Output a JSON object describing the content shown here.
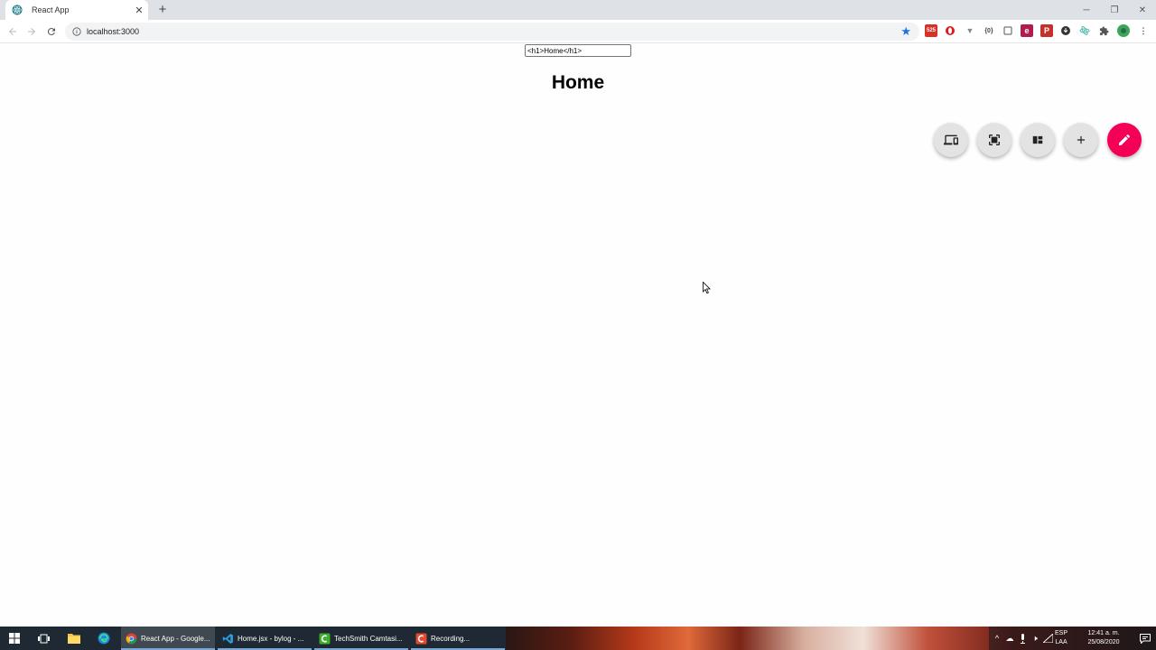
{
  "browser": {
    "tab": {
      "title": "React App",
      "favicon": "react-logo-icon"
    },
    "address": {
      "url": "localhost:3000",
      "info_icon": "info-icon"
    },
    "bookmark_icon": "star-icon",
    "extensions": [
      "gmail-extension-icon",
      "opera-extension-icon",
      "vue-devtools-icon",
      "json-extension-icon",
      "square-extension-icon",
      "extension-icon",
      "pdf-extension-icon",
      "download-extension-icon",
      "react-devtools-icon",
      "puzzle-extensions-icon",
      "profile-avatar"
    ],
    "gmail_badge": "525",
    "window_controls": {
      "minimize": "─",
      "restore": "❐",
      "close": "✕"
    }
  },
  "page": {
    "editor_input_value": "<h1>Home</h1>",
    "heading": "Home",
    "fab_buttons": [
      "devices-icon",
      "fullscreen-select-icon",
      "dashboard-icon",
      "add-icon",
      "edit-icon"
    ],
    "fab_main_color": "#f50057"
  },
  "taskbar": {
    "items": [
      {
        "label": "React App - Google...",
        "icon": "chrome-icon"
      },
      {
        "label": "Home.jsx - bylog - ...",
        "icon": "vscode-icon"
      },
      {
        "label": "TechSmith Camtasi...",
        "icon": "camtasia-icon"
      },
      {
        "label": "Recording...",
        "icon": "camtasia-recorder-icon"
      }
    ],
    "language_top": "ESP",
    "language_bottom": "LAA",
    "time": "12:41 a. m.",
    "date": "25/08/2020"
  }
}
